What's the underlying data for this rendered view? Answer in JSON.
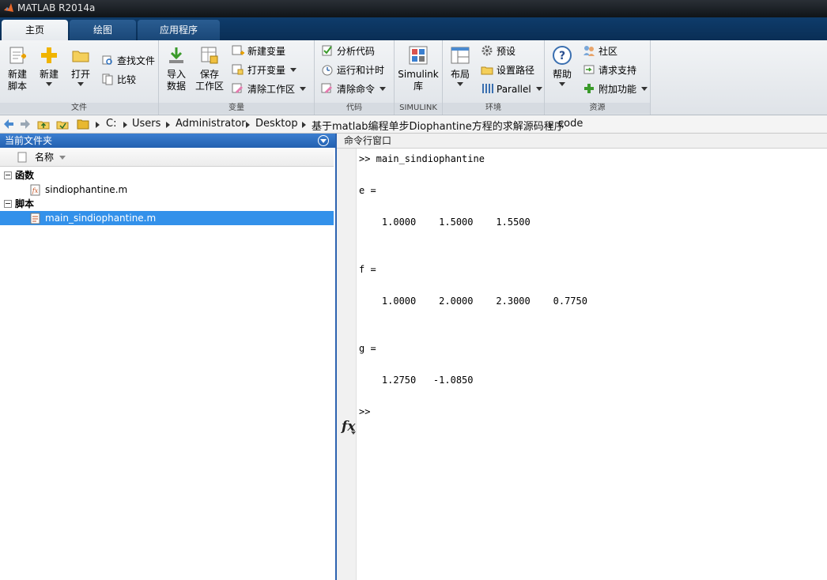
{
  "window": {
    "title": "MATLAB R2014a"
  },
  "tabs": [
    {
      "label": "主页",
      "active": true
    },
    {
      "label": "绘图",
      "active": false
    },
    {
      "label": "应用程序",
      "active": false
    }
  ],
  "ribbon": {
    "groups": {
      "file": "文件",
      "variable": "变量",
      "code": "代码",
      "simulink": "SIMULINK",
      "environment": "环境",
      "resources": "资源"
    },
    "new_script": [
      "新建",
      "脚本"
    ],
    "new": "新建",
    "open": "打开",
    "find_files": "查找文件",
    "compare": "比较",
    "import_data": [
      "导入",
      "数据"
    ],
    "save_workspace": [
      "保存",
      "工作区"
    ],
    "new_variable": "新建变量",
    "open_variable": "打开变量",
    "clear_workspace": "清除工作区",
    "analyze_code": "分析代码",
    "run_and_time": "运行和计时",
    "clear_commands": "清除命令",
    "simulink_library": [
      "Simulink",
      "库"
    ],
    "layout": "布局",
    "preferences": "预设",
    "set_path": "设置路径",
    "parallel": "Parallel",
    "help": "帮助",
    "community": "社区",
    "request_support": "请求支持",
    "add_ons": "附加功能"
  },
  "address": {
    "crumbs": [
      "C:",
      "Users",
      "Administrator",
      "Desktop",
      "基于matlab编程单步Diophantine方程的求解源码程序",
      "code"
    ]
  },
  "current_folder": {
    "title": "当前文件夹",
    "column_name": "名称",
    "groups": [
      {
        "label": "函数",
        "files": [
          "sindiophantine.m"
        ]
      },
      {
        "label": "脚本",
        "files": [
          "main_sindiophantine.m"
        ]
      }
    ]
  },
  "command_window": {
    "title": "命令行窗口",
    "lines": {
      "cmd": ">> main_sindiophantine",
      "e_label": "e =",
      "e_values": "    1.0000    1.5000    1.5500",
      "f_label": "f =",
      "f_values": "    1.0000    2.0000    2.3000    0.7750",
      "g_label": "g =",
      "g_values": "    1.2750   -1.0850",
      "prompt": ">>"
    },
    "fx_label": "fx"
  },
  "colors": {
    "accent": "#2c63b0",
    "selection": "#3391ea",
    "tab_bg": "#0e3c6b"
  }
}
